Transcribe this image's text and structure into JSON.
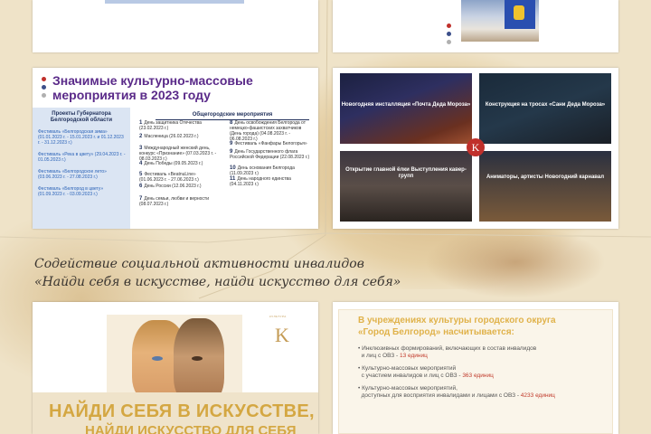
{
  "events_card": {
    "title_line1": "Значимые культурно-массовые",
    "title_line2": "мероприятия в 2023 году",
    "projects_header": "Проекты Губернатора Белгородской области",
    "projects": [
      "Фестиваль «Белгородская зима» (01.01.2023 г. - 15.01.2023 г. и 01.12.2023 г. - 31.12.2023 г.)",
      "Фестиваль «Река в цвету» (29.04.2023 г. - 01.05.2023 г.)",
      "Фестиваль «Белгородское лето» (03.06.2023 г. - 27.08.2023 г.)",
      "Фестиваль «Белгород в цвету» (01.09.2023 г. - 03.09.2023 г.)"
    ],
    "city_header": "Общегородские мероприятия",
    "city_events": [
      {
        "n": "1",
        "text": "День защитника Отечества (23.02.2023 г.)"
      },
      {
        "n": "2",
        "text": "Масленица (26.02.2023 г.)"
      },
      {
        "n": "3",
        "text": "Международный женский день, конкурс «Признание» (07.03.2023 г. - 08.03.2023 г.)"
      },
      {
        "n": "4",
        "text": "День Победы (09.05.2023 г.)"
      },
      {
        "n": "5",
        "text": "Фестиваль «BeatnuLine» (01.06.2023 г. - 27.06.2023 г.)"
      },
      {
        "n": "6",
        "text": "День России (12.06.2023 г.)"
      },
      {
        "n": "7",
        "text": "День семьи, любви и верности (08.07.2023 г.)"
      },
      {
        "n": "8",
        "text": "День освобождения Белгорода от немецко-фашистских захватчиков (День города) (04.08.2023 г. - 06.08.2023 г.)"
      },
      {
        "n": "9",
        "text": "Фестиваль «Фанфары Белогорья»"
      },
      {
        "n": "9",
        "text": "День Государственного флага Российской Федерации (22.08.2023 г.)"
      },
      {
        "n": "10",
        "text": "День основания Белгорода (11.09.2023 г.)"
      },
      {
        "n": "11",
        "text": "День народного единства (04.11.2023 г.)"
      }
    ]
  },
  "photos_card": {
    "captions": [
      "Новогодняя инсталляция «Почта Деда Мороза»",
      "Конструкция на тросах «Сани Деда Мороза»",
      "Открытие главной ёлки Выступления кавер-групп",
      "Аниматоры, артисты Новогодний карнавал"
    ],
    "logo_letter": "K"
  },
  "section": {
    "line1": "Содействие социальной активности инвалидов",
    "line2": "«Найди себя в искусстве, найди искусство для себя»"
  },
  "poster": {
    "logo_letter": "K",
    "logo_caption": "КУЛЬТУРА",
    "slogan_line1": "НАЙДИ СЕБЯ В ИСКУССТВЕ,",
    "slogan_line2": "НАЙДИ ИСКУССТВО ДЛЯ СЕБЯ"
  },
  "stats_card": {
    "title_line1": "В учреждениях культуры городского округа",
    "title_line2": "«Город Белгород» насчитывается:",
    "items": [
      {
        "line1": "Инклюзивных формирований, включающих в состав инвалидов",
        "line2": "и лиц с ОВЗ - ",
        "value": "13 единиц"
      },
      {
        "line1": "Культурно-массовых мероприятий",
        "line2": "с участием инвалидов и лиц с ОВЗ - ",
        "value": "363 единиц"
      },
      {
        "line1": "Культурно-массовых мероприятий,",
        "line2": "доступных для восприятия инвалидами и лицами с ОВЗ - ",
        "value": "4233 единиц"
      }
    ]
  },
  "colors": {
    "accent_purple": "#5a2a89",
    "accent_gold": "#e0b24a",
    "accent_red": "#c0302b",
    "panel_blue": "#dbe5f3",
    "background": "#efe3c8"
  }
}
